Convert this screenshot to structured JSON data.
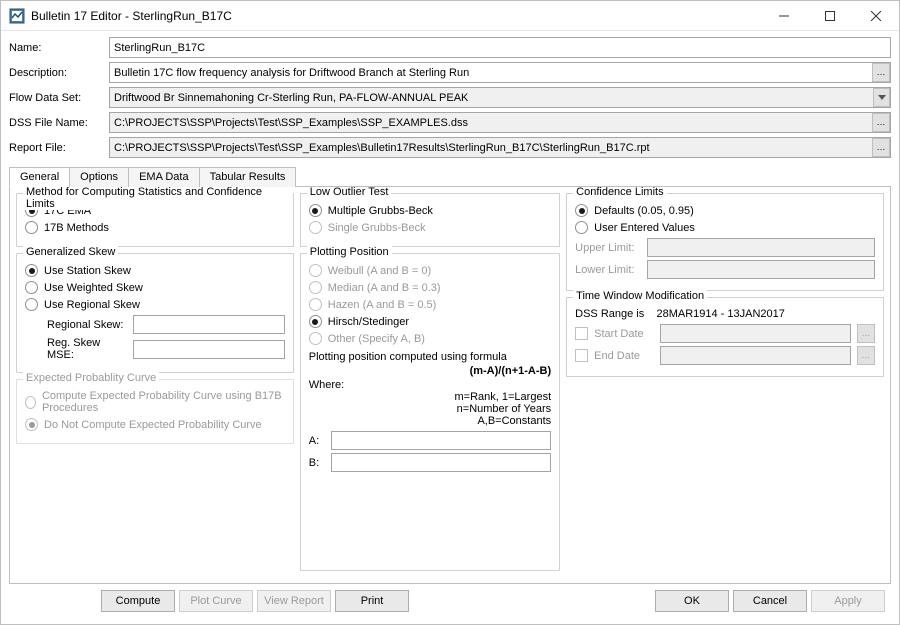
{
  "window": {
    "title": "Bulletin 17 Editor - SterlingRun_B17C"
  },
  "form": {
    "name_label": "Name:",
    "name_value": "SterlingRun_B17C",
    "description_label": "Description:",
    "description_value": "Bulletin 17C flow frequency analysis for Driftwood Branch at Sterling Run",
    "flow_data_set_label": "Flow Data Set:",
    "flow_data_set_value": "Driftwood Br Sinnemahoning Cr-Sterling Run, PA-FLOW-ANNUAL PEAK",
    "dss_file_label": "DSS File Name:",
    "dss_file_value": "C:\\PROJECTS\\SSP\\Projects\\Test\\SSP_Examples\\SSP_EXAMPLES.dss",
    "report_file_label": "Report File:",
    "report_file_value": "C:\\PROJECTS\\SSP\\Projects\\Test\\SSP_Examples\\Bulletin17Results\\SterlingRun_B17C\\SterlingRun_B17C.rpt"
  },
  "tabs": [
    {
      "label": "General"
    },
    {
      "label": "Options"
    },
    {
      "label": "EMA Data"
    },
    {
      "label": "Tabular Results"
    }
  ],
  "general": {
    "method": {
      "title": "Method for Computing Statistics and Confidence Limits",
      "opt_ema": "17C EMA",
      "opt_17b": "17B Methods"
    },
    "skew": {
      "title": "Generalized Skew",
      "opt_station": "Use Station Skew",
      "opt_weighted": "Use Weighted Skew",
      "opt_regional": "Use Regional Skew",
      "regional_skew_label": "Regional Skew:",
      "reg_skew_mse_label": "Reg. Skew MSE:"
    },
    "expected": {
      "title": "Expected Probablity Curve",
      "opt_compute": "Compute Expected Probability Curve using B17B Procedures",
      "opt_dont": "Do Not Compute Expected Probability Curve"
    },
    "lowoutlier": {
      "title": "Low Outlier Test",
      "opt_multi": "Multiple Grubbs-Beck",
      "opt_single": "Single Grubbs-Beck"
    },
    "plotting": {
      "title": "Plotting Position",
      "opt_weibull": "Weibull (A and B = 0)",
      "opt_median": "Median (A and B = 0.3)",
      "opt_hazen": "Hazen (A and B = 0.5)",
      "opt_hirsch": "Hirsch/Stedinger",
      "opt_other": "Other (Specify A, B)",
      "formula_intro": "Plotting position computed using formula",
      "formula": "(m-A)/(n+1-A-B)",
      "where": "Where:",
      "legend_m": "m=Rank, 1=Largest",
      "legend_n": "n=Number of Years",
      "legend_ab": "A,B=Constants",
      "a_label": "A:",
      "b_label": "B:"
    },
    "confidence": {
      "title": "Confidence Limits",
      "opt_defaults": "Defaults (0.05, 0.95)",
      "opt_user": "User Entered Values",
      "upper_label": "Upper Limit:",
      "lower_label": "Lower Limit:"
    },
    "timewindow": {
      "title": "Time Window Modification",
      "range_label": "DSS Range is",
      "range_value": "28MAR1914 - 13JAN2017",
      "start_label": "Start Date",
      "end_label": "End Date"
    }
  },
  "footer": {
    "compute": "Compute",
    "plot_curve": "Plot Curve",
    "view_report": "View Report",
    "print": "Print",
    "ok": "OK",
    "cancel": "Cancel",
    "apply": "Apply"
  }
}
